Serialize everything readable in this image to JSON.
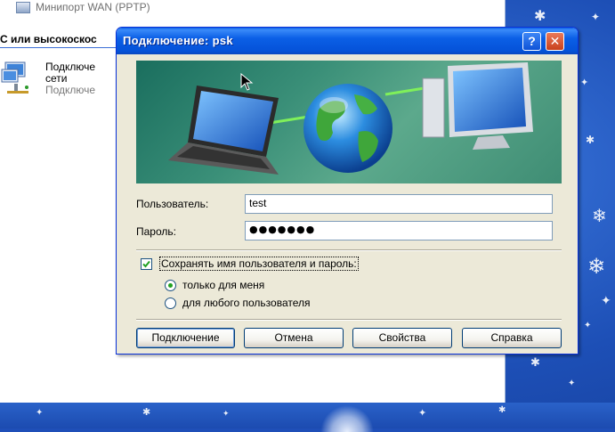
{
  "background_window": {
    "top_item_label": "Минипорт WAN (PPTP)",
    "group_header": "С или высокоскос",
    "connection_item": {
      "line1": "Подключе",
      "line2": "сети",
      "line3": "Подключе"
    }
  },
  "dialog": {
    "title": "Подключение: psk",
    "help_glyph": "?",
    "close_glyph": "✕",
    "user_label": "Пользователь:",
    "user_value": "test",
    "password_label": "Пароль:",
    "password_value": "●●●●●●●",
    "save_checkbox_label": "Сохранять имя пользователя и пароль:",
    "save_checked": true,
    "radio_only_me": "только для меня",
    "radio_any_user": "для любого пользователя",
    "selected_radio": "only_me",
    "buttons": {
      "connect": "Подключение",
      "cancel": "Отмена",
      "properties": "Свойства",
      "help": "Справка"
    }
  },
  "colors": {
    "title_bar": "#0b5fe6",
    "dialog_bg": "#ece9d8",
    "desktop": "#1f4fb8",
    "banner": "#3a8f78"
  }
}
